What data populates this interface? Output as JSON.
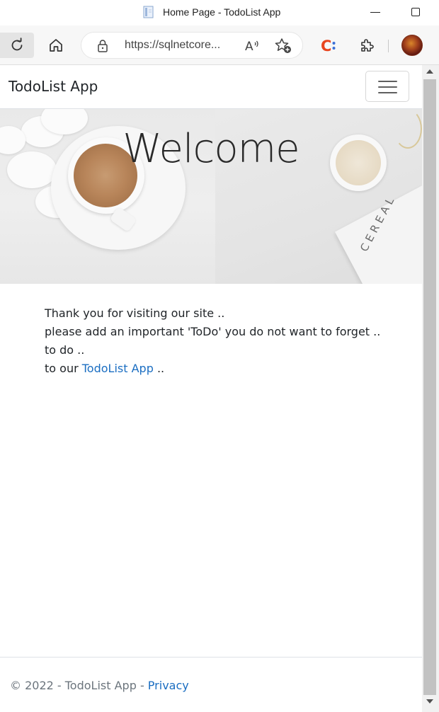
{
  "browser": {
    "tab_title": "Home Page - TodoList App",
    "url": "https://sqlnetcore...",
    "icons": {
      "refresh": "refresh-icon",
      "home": "home-icon",
      "lock": "lock-icon",
      "read_aloud": "read-aloud-icon",
      "favorites": "add-favorite-icon",
      "extension_c": "extension-c-icon",
      "extensions": "puzzle-icon",
      "profile": "avatar"
    },
    "accent_extension_color": "#e8451f"
  },
  "navbar": {
    "brand": "TodoList App"
  },
  "hero": {
    "heading": "Welcome",
    "box_text": "CEREAL"
  },
  "content": {
    "line1": "Thank you for visiting our site ..",
    "line2": "please add an important 'ToDo' you do not want to forget ..",
    "line3": "to do ..",
    "line4_prefix": "to our ",
    "line4_link": "TodoList App",
    "line4_suffix": " .."
  },
  "footer": {
    "text": "© 2022 - TodoList App - ",
    "privacy_link": "Privacy"
  },
  "colors": {
    "link": "#1b6ec2",
    "text": "#212529",
    "muted": "#6c757d"
  }
}
